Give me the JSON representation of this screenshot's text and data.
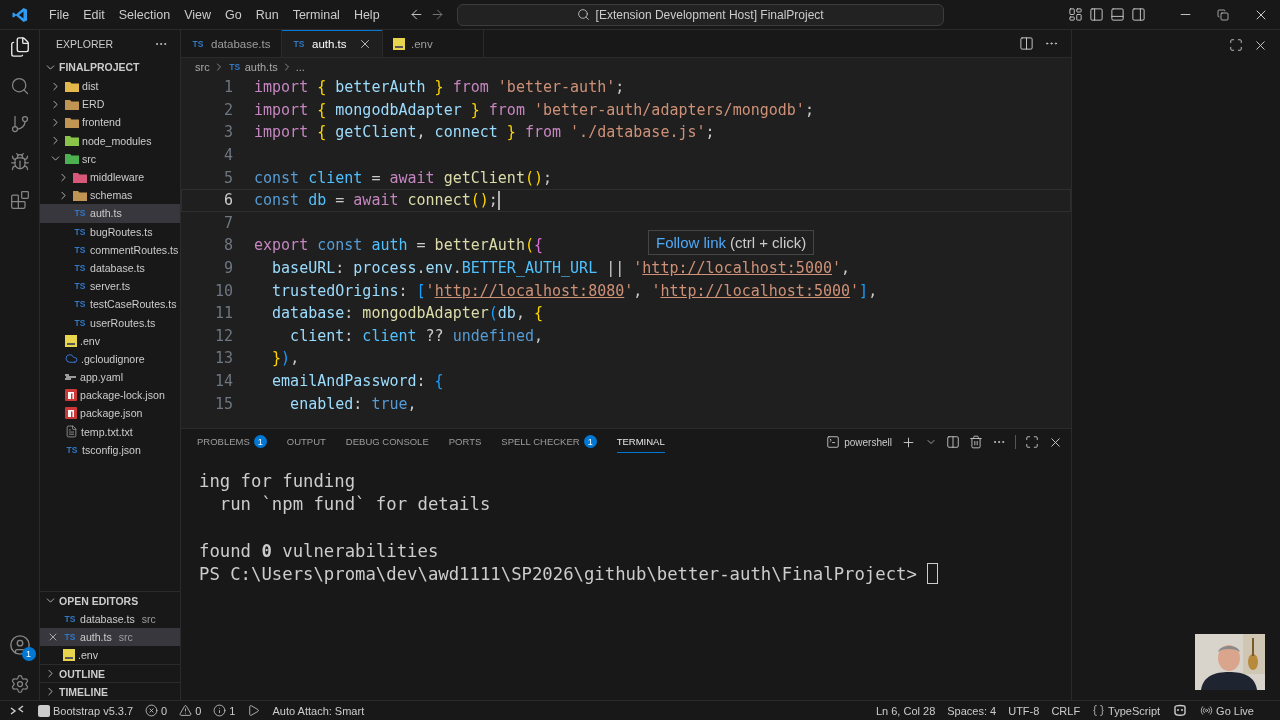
{
  "menu": [
    "File",
    "Edit",
    "Selection",
    "View",
    "Go",
    "Run",
    "Terminal",
    "Help"
  ],
  "command_center": {
    "text": "[Extension Development Host] FinalProject"
  },
  "activity": {
    "accounts_badge": "1"
  },
  "explorer": {
    "title": "EXPLORER",
    "project": "FINALPROJECT",
    "tree": [
      {
        "name": "dist",
        "kind": "folder",
        "color": "#e2b84a",
        "expanded": false,
        "selected": false
      },
      {
        "name": "ERD",
        "kind": "folder",
        "color": "#c09553",
        "expanded": false,
        "selected": false
      },
      {
        "name": "frontend",
        "kind": "folder",
        "color": "#c09553",
        "expanded": false,
        "selected": false
      },
      {
        "name": "node_modules",
        "kind": "folder",
        "color": "#8bc34a",
        "expanded": false,
        "selected": false
      },
      {
        "name": "src",
        "kind": "folder",
        "color": "#4caf50",
        "expanded": true,
        "selected": false,
        "children": [
          {
            "name": "middleware",
            "kind": "folder",
            "color": "#d8587a",
            "expanded": false,
            "selected": false
          },
          {
            "name": "schemas",
            "kind": "folder",
            "color": "#c09553",
            "expanded": false,
            "selected": false
          },
          {
            "name": "auth.ts",
            "kind": "ts",
            "icon_text": "TS",
            "selected": true
          },
          {
            "name": "bugRoutes.ts",
            "kind": "ts",
            "icon_text": "TS",
            "selected": false
          },
          {
            "name": "commentRoutes.ts",
            "kind": "ts",
            "icon_text": "TS",
            "selected": false
          },
          {
            "name": "database.ts",
            "kind": "ts",
            "icon_text": "TS",
            "selected": false
          },
          {
            "name": "server.ts",
            "kind": "ts",
            "icon_text": "TS",
            "selected": false
          },
          {
            "name": "testCaseRoutes.ts",
            "kind": "ts",
            "icon_text": "TS",
            "selected": false
          },
          {
            "name": "userRoutes.ts",
            "kind": "ts",
            "icon_text": "TS",
            "selected": false
          }
        ]
      },
      {
        "name": ".env",
        "kind": "env",
        "selected": false
      },
      {
        "name": ".gcloudignore",
        "kind": "cloud",
        "selected": false
      },
      {
        "name": "app.yaml",
        "kind": "yaml",
        "selected": false
      },
      {
        "name": "package-lock.json",
        "kind": "npm",
        "selected": false
      },
      {
        "name": "package.json",
        "kind": "npm",
        "selected": false
      },
      {
        "name": "temp.txt.txt",
        "kind": "txt",
        "selected": false
      },
      {
        "name": "tsconfig.json",
        "kind": "ts",
        "icon_text": "TS",
        "selected": false
      }
    ]
  },
  "open_editors": {
    "title": "OPEN EDITORS",
    "items": [
      {
        "name": "database.ts",
        "kind": "ts",
        "icon_text": "TS",
        "folder": "src",
        "selected": false
      },
      {
        "name": "auth.ts",
        "kind": "ts",
        "icon_text": "TS",
        "folder": "src",
        "selected": true
      },
      {
        "name": ".env",
        "kind": "env",
        "selected": false
      }
    ]
  },
  "sections": [
    {
      "title": "OUTLINE",
      "expanded": false
    },
    {
      "title": "TIMELINE",
      "expanded": false
    }
  ],
  "tabs": [
    {
      "name": "database.ts",
      "kind": "ts",
      "icon_text": "TS",
      "selected": false
    },
    {
      "name": "auth.ts",
      "kind": "ts",
      "icon_text": "TS",
      "selected": true
    },
    {
      "name": ".env",
      "kind": "env",
      "selected": false
    }
  ],
  "breadcrumb": [
    {
      "text": "src",
      "kind": "folder"
    },
    {
      "text": "auth.ts",
      "kind": "ts",
      "icon_text": "TS"
    },
    {
      "text": "...",
      "kind": "more"
    }
  ],
  "code": [
    {
      "number": "1",
      "current": false,
      "tokens": [
        {
          "kind": "kw",
          "text": "import"
        },
        {
          "kind": "b1",
          "text": " {"
        },
        {
          "kind": "var",
          "text": " betterAuth"
        },
        {
          "kind": "b1",
          "text": " }"
        },
        {
          "kind": "kw",
          "text": " from"
        },
        {
          "kind": "str",
          "text": " 'better-auth'"
        },
        {
          "kind": "p",
          "text": ";"
        }
      ]
    },
    {
      "number": "2",
      "current": false,
      "tokens": [
        {
          "kind": "kw",
          "text": "import"
        },
        {
          "kind": "b1",
          "text": " {"
        },
        {
          "kind": "var",
          "text": " mongodbAdapter"
        },
        {
          "kind": "b1",
          "text": " }"
        },
        {
          "kind": "kw",
          "text": " from"
        },
        {
          "kind": "str",
          "text": " 'better-auth/adapters/mongodb'"
        },
        {
          "kind": "p",
          "text": ";"
        }
      ]
    },
    {
      "number": "3",
      "current": false,
      "tokens": [
        {
          "kind": "kw",
          "text": "import"
        },
        {
          "kind": "b1",
          "text": " {"
        },
        {
          "kind": "var",
          "text": " getClient"
        },
        {
          "kind": "p",
          "text": ","
        },
        {
          "kind": "var",
          "text": " connect"
        },
        {
          "kind": "b1",
          "text": " }"
        },
        {
          "kind": "kw",
          "text": " from"
        },
        {
          "kind": "str",
          "text": " './database.js'"
        },
        {
          "kind": "p",
          "text": ";"
        }
      ]
    },
    {
      "number": "4",
      "current": false
    },
    {
      "number": "5",
      "current": false,
      "tokens": [
        {
          "kind": "decl",
          "text": "const"
        },
        {
          "kind": "const",
          "text": " client"
        },
        {
          "kind": "p",
          "text": " ="
        },
        {
          "kind": "kw",
          "text": " await"
        },
        {
          "kind": "fn",
          "text": " getClient"
        },
        {
          "kind": "b1",
          "text": "()"
        },
        {
          "kind": "p",
          "text": ";"
        }
      ]
    },
    {
      "number": "6",
      "current": true,
      "tokens": [
        {
          "kind": "decl",
          "text": "const"
        },
        {
          "kind": "const",
          "text": " db"
        },
        {
          "kind": "p",
          "text": " ="
        },
        {
          "kind": "kw",
          "text": " await"
        },
        {
          "kind": "fn",
          "text": " connect"
        },
        {
          "kind": "b1",
          "text": "()"
        },
        {
          "kind": "p",
          "text": ";"
        }
      ]
    },
    {
      "number": "7",
      "current": false
    },
    {
      "number": "8",
      "current": false,
      "tokens": [
        {
          "kind": "kw",
          "text": "export"
        },
        {
          "kind": "decl",
          "text": " const"
        },
        {
          "kind": "const",
          "text": " auth"
        },
        {
          "kind": "p",
          "text": " ="
        },
        {
          "kind": "fn",
          "text": " betterAuth"
        },
        {
          "kind": "b1",
          "text": "("
        },
        {
          "kind": "b2",
          "text": "{"
        }
      ]
    },
    {
      "number": "9",
      "current": false,
      "tokens": [
        {
          "kind": "var",
          "text": "  baseURL"
        },
        {
          "kind": "p",
          "text": ":"
        },
        {
          "kind": "var",
          "text": " process"
        },
        {
          "kind": "p",
          "text": "."
        },
        {
          "kind": "var",
          "text": "env"
        },
        {
          "kind": "p",
          "text": "."
        },
        {
          "kind": "const",
          "text": "BETTER_AUTH_URL"
        },
        {
          "kind": "p",
          "text": " || "
        },
        {
          "kind": "str",
          "text": "'"
        },
        {
          "kind": "link",
          "text": "http://localhost:5000"
        },
        {
          "kind": "str",
          "text": "'"
        },
        {
          "kind": "p",
          "text": ","
        }
      ]
    },
    {
      "number": "10",
      "current": false,
      "tokens": [
        {
          "kind": "var",
          "text": "  trustedOrigins"
        },
        {
          "kind": "p",
          "text": ":"
        },
        {
          "kind": "b3",
          "text": " ["
        },
        {
          "kind": "str",
          "text": "'"
        },
        {
          "kind": "link",
          "text": "http://localhost:8080"
        },
        {
          "kind": "str",
          "text": "'"
        },
        {
          "kind": "p",
          "text": ", "
        },
        {
          "kind": "str",
          "text": "'"
        },
        {
          "kind": "link",
          "text": "http://localhost:5000"
        },
        {
          "kind": "str",
          "text": "'"
        },
        {
          "kind": "b3",
          "text": "]"
        },
        {
          "kind": "p",
          "text": ","
        }
      ]
    },
    {
      "number": "11",
      "current": false,
      "tokens": [
        {
          "kind": "var",
          "text": "  database"
        },
        {
          "kind": "p",
          "text": ":"
        },
        {
          "kind": "fn",
          "text": " mongodbAdapter"
        },
        {
          "kind": "b3",
          "text": "("
        },
        {
          "kind": "var",
          "text": "db"
        },
        {
          "kind": "p",
          "text": ","
        },
        {
          "kind": "b1",
          "text": " {"
        }
      ]
    },
    {
      "number": "12",
      "current": false,
      "tokens": [
        {
          "kind": "var",
          "text": "    client"
        },
        {
          "kind": "p",
          "text": ":"
        },
        {
          "kind": "const",
          "text": " client"
        },
        {
          "kind": "p",
          "text": " ??"
        },
        {
          "kind": "lit",
          "text": " undefined"
        },
        {
          "kind": "p",
          "text": ","
        }
      ]
    },
    {
      "number": "13",
      "current": false,
      "tokens": [
        {
          "kind": "b1",
          "text": "  }"
        },
        {
          "kind": "b3",
          "text": ")"
        },
        {
          "kind": "p",
          "text": ","
        }
      ]
    },
    {
      "number": "14",
      "current": false,
      "tokens": [
        {
          "kind": "var",
          "text": "  emailAndPassword"
        },
        {
          "kind": "p",
          "text": ":"
        },
        {
          "kind": "b3",
          "text": " {"
        }
      ]
    },
    {
      "number": "15",
      "current": false,
      "tokens": [
        {
          "kind": "var",
          "text": "    enabled"
        },
        {
          "kind": "p",
          "text": ":"
        },
        {
          "kind": "lit",
          "text": " true"
        },
        {
          "kind": "p",
          "text": ","
        }
      ]
    }
  ],
  "tooltip": {
    "link": "Follow link",
    "hint": "(ctrl + click)"
  },
  "panel": {
    "tabs": [
      {
        "label": "PROBLEMS",
        "badge": "1",
        "selected": false
      },
      {
        "label": "OUTPUT",
        "selected": false
      },
      {
        "label": "DEBUG CONSOLE",
        "selected": false
      },
      {
        "label": "PORTS",
        "selected": false
      },
      {
        "label": "SPELL CHECKER",
        "badge": "1",
        "selected": false
      },
      {
        "label": "TERMINAL",
        "selected": true
      }
    ],
    "shell": "powershell",
    "terminal": [
      {
        "text": "ing for funding"
      },
      {
        "text": "  run `npm fund` for details"
      },
      {
        "text": "found **0** vulnerabilities",
        "blank_before": true
      },
      {
        "text": "PS C:\\Users\\proma\\dev\\awd1111\\SP2026\\github\\better-auth\\FinalProject> ",
        "cursor": true
      }
    ]
  },
  "status_bar": {
    "left": [
      {
        "kind": "bootstrap",
        "text": "Bootstrap v5.3.7"
      },
      {
        "kind": "errors",
        "text": "0"
      },
      {
        "kind": "warnings",
        "text": "0"
      },
      {
        "kind": "info",
        "text": "1"
      },
      {
        "kind": "debug"
      },
      {
        "kind": "plain",
        "text": "Auto Attach: Smart"
      }
    ],
    "right": [
      {
        "kind": "plain",
        "text": "Ln 6, Col 28"
      },
      {
        "kind": "plain",
        "text": "Spaces: 4"
      },
      {
        "kind": "plain",
        "text": "UTF-8"
      },
      {
        "kind": "plain",
        "text": "CRLF"
      },
      {
        "kind": "language",
        "text": "TypeScript"
      },
      {
        "kind": "copilot"
      },
      {
        "kind": "live",
        "text": "Go Live"
      }
    ]
  },
  "webcam": {
    "kind": "picture"
  }
}
